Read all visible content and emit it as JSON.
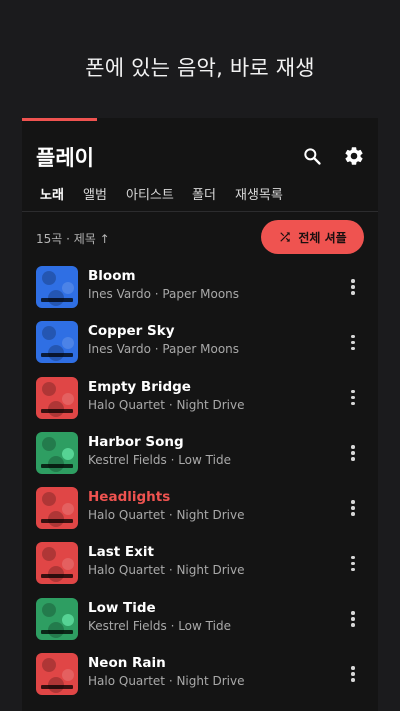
{
  "headline": "폰에 있는 음악, 바로 재생",
  "app": {
    "title": "플레이",
    "tabs": [
      {
        "label": "노래",
        "active": true
      },
      {
        "label": "앨범",
        "active": false
      },
      {
        "label": "아티스트",
        "active": false
      },
      {
        "label": "폴더",
        "active": false
      },
      {
        "label": "재생목록",
        "active": false
      }
    ],
    "sort_label": "15곡 · 제목 ↑",
    "shuffle_label": "전체 셔플",
    "colors": {
      "accent": "#ef5350",
      "background": "#141414",
      "art_blue": "#2f6fe4",
      "art_red": "#e04646",
      "art_green": "#2e9e62"
    },
    "icons": {
      "search": "search-icon",
      "settings": "gear-icon",
      "shuffle": "shuffle-icon",
      "more": "more-vertical-icon"
    },
    "tracks": [
      {
        "title": "Bloom",
        "subtitle": "Ines Vardo · Paper Moons",
        "art": "blue",
        "playing": false
      },
      {
        "title": "Copper Sky",
        "subtitle": "Ines Vardo · Paper Moons",
        "art": "blue",
        "playing": false
      },
      {
        "title": "Empty Bridge",
        "subtitle": "Halo Quartet · Night Drive",
        "art": "red",
        "playing": false
      },
      {
        "title": "Harbor Song",
        "subtitle": "Kestrel Fields · Low Tide",
        "art": "green",
        "playing": false
      },
      {
        "title": "Headlights",
        "subtitle": "Halo Quartet · Night Drive",
        "art": "red",
        "playing": true
      },
      {
        "title": "Last Exit",
        "subtitle": "Halo Quartet · Night Drive",
        "art": "red",
        "playing": false
      },
      {
        "title": "Low Tide",
        "subtitle": "Kestrel Fields · Low Tide",
        "art": "green",
        "playing": false
      },
      {
        "title": "Neon Rain",
        "subtitle": "Halo Quartet · Night Drive",
        "art": "red",
        "playing": false
      }
    ]
  }
}
